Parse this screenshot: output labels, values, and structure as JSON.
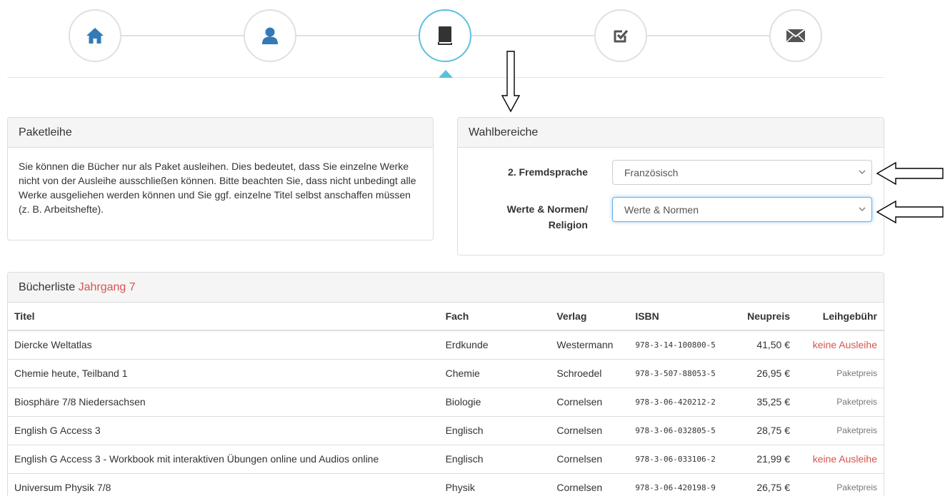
{
  "wizard": {
    "steps": [
      {
        "icon": "home-icon",
        "active": false
      },
      {
        "icon": "user-icon",
        "active": false
      },
      {
        "icon": "book-icon",
        "active": true
      },
      {
        "icon": "check-square-icon",
        "active": false
      },
      {
        "icon": "envelope-icon",
        "active": false
      }
    ],
    "accent_color": "#5bc0de"
  },
  "paketleihe": {
    "title": "Paketleihe",
    "text": "Sie können die Bücher nur als Paket ausleihen. Dies bedeutet, dass Sie einzelne Werke nicht von der Ausleihe ausschließen können. Bitte beachten Sie, dass nicht unbedingt alle Werke ausgeliehen werden können und Sie ggf. einzelne Titel selbst anschaffen müssen (z. B. Arbeitshefte)."
  },
  "wahlbereiche": {
    "title": "Wahlbereiche",
    "fields": [
      {
        "label": "2. Fremdsprache",
        "value": "Französisch"
      },
      {
        "label": "Werte & Normen/ Religion",
        "value": "Werte & Normen"
      }
    ]
  },
  "buecherliste": {
    "title": "Bücherliste",
    "jahrgang": "Jahrgang 7",
    "columns": [
      "Titel",
      "Fach",
      "Verlag",
      "ISBN",
      "Neupreis",
      "Leihgebühr"
    ],
    "rows": [
      {
        "titel": "Diercke Weltatlas",
        "fach": "Erdkunde",
        "verlag": "Westermann",
        "isbn": "978-3-14-100800-5",
        "preis": "41,50 €",
        "gebuehr": "keine Ausleihe",
        "red": true
      },
      {
        "titel": "Chemie heute, Teilband 1",
        "fach": "Chemie",
        "verlag": "Schroedel",
        "isbn": "978-3-507-88053-5",
        "preis": "26,95 €",
        "gebuehr": "Paketpreis",
        "red": false
      },
      {
        "titel": "Biosphäre 7/8 Niedersachsen",
        "fach": "Biologie",
        "verlag": "Cornelsen",
        "isbn": "978-3-06-420212-2",
        "preis": "35,25 €",
        "gebuehr": "Paketpreis",
        "red": false
      },
      {
        "titel": "English G Access 3",
        "fach": "Englisch",
        "verlag": "Cornelsen",
        "isbn": "978-3-06-032805-5",
        "preis": "28,75 €",
        "gebuehr": "Paketpreis",
        "red": false
      },
      {
        "titel": "English G Access 3 - Workbook mit interaktiven Übungen online und Audios online",
        "fach": "Englisch",
        "verlag": "Cornelsen",
        "isbn": "978-3-06-033106-2",
        "preis": "21,99 €",
        "gebuehr": "keine Ausleihe",
        "red": true
      },
      {
        "titel": "Universum Physik 7/8",
        "fach": "Physik",
        "verlag": "Cornelsen",
        "isbn": "978-3-06-420198-9",
        "preis": "26,75 €",
        "gebuehr": "Paketpreis",
        "red": false
      }
    ]
  }
}
